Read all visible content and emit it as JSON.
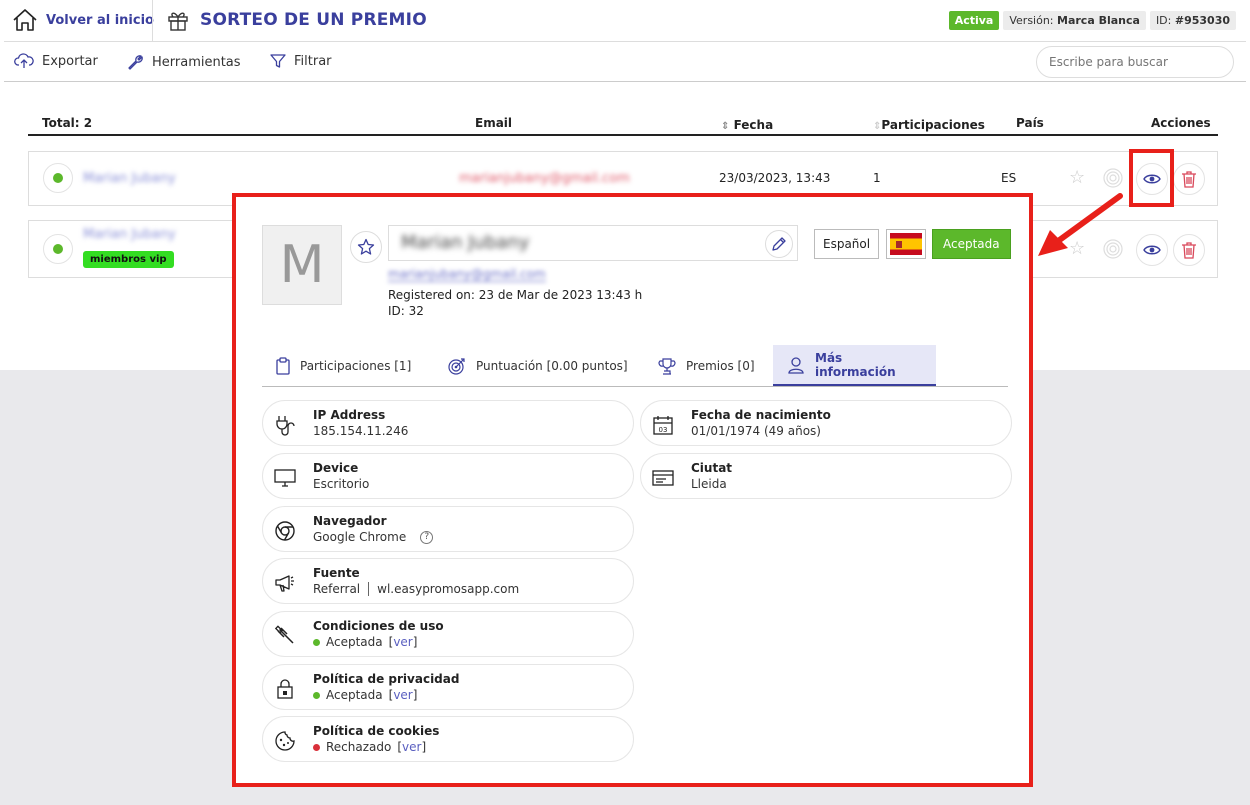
{
  "header": {
    "home_label": "Volver al inicio",
    "title": "SORTEO DE UN PREMIO",
    "status": "Activa",
    "version_label": "Versión:",
    "version_value": "Marca Blanca",
    "id_label": "ID:",
    "id_value": "#953030"
  },
  "toolbar": {
    "export": "Exportar",
    "tools": "Herramientas",
    "filter": "Filtrar",
    "search_placeholder": "Escribe para buscar"
  },
  "table": {
    "headers": {
      "total": "Total: 2",
      "email": "Email",
      "date": "Fecha",
      "participations": "Participaciones",
      "country": "País",
      "actions": "Acciones"
    },
    "rows": [
      {
        "name": "Marian Jubany",
        "email": "marianjubany@gmail.com",
        "date": "23/03/2023, 13:43",
        "participations": "1",
        "country": "ES",
        "tag": ""
      },
      {
        "name": "Marian Jubany",
        "email": "",
        "date": "",
        "participations": "",
        "country": "",
        "tag": "miembros vip"
      }
    ]
  },
  "modal": {
    "avatar_letter": "M",
    "name": "Marian Jubany",
    "email": "marianjubany@gmail.com",
    "registered": "Registered on: 23 de Mar de 2023 13:43 h",
    "id": "ID: 32",
    "language": "Español",
    "status": "Aceptada",
    "tabs": [
      {
        "label": "Participaciones [1]",
        "icon": "clipboard-icon"
      },
      {
        "label": "Puntuación [0.00 puntos]",
        "icon": "target-icon"
      },
      {
        "label": "Premios [0]",
        "icon": "trophy-icon"
      },
      {
        "label": "Más información",
        "icon": "user-icon"
      }
    ],
    "info": {
      "ip": {
        "title": "IP Address",
        "value": "185.154.11.246"
      },
      "birth": {
        "title": "Fecha de nacimiento",
        "value": "01/01/1974 (49 años)",
        "icon_text": "03"
      },
      "device": {
        "title": "Device",
        "value": "Escritorio"
      },
      "city": {
        "title": "Ciutat",
        "value": "Lleida"
      },
      "browser": {
        "title": "Navegador",
        "value": "Google Chrome",
        "help": "?"
      },
      "source": {
        "title": "Fuente",
        "value": "Referral",
        "value2": "wl.easypromosapp.com"
      },
      "terms": {
        "title": "Condiciones de uso",
        "value": "Aceptada",
        "link": "ver"
      },
      "privacy": {
        "title": "Política de privacidad",
        "value": "Aceptada",
        "link": "ver"
      },
      "cookies": {
        "title": "Política de cookies",
        "value": "Rechazado",
        "link": "ver"
      }
    }
  },
  "colors": {
    "accent": "#3a3f9d",
    "green": "#5cb82b",
    "red_highlight": "#e8201a",
    "rejected": "#d9303a"
  }
}
